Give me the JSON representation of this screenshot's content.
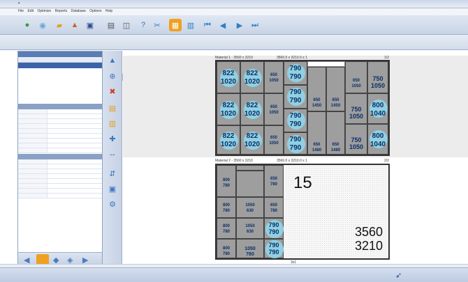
{
  "menu": [
    "File",
    "Edit",
    "Optimize",
    "Reports",
    "Database",
    "Options",
    "Help"
  ],
  "sheet1": {
    "header": "Material 1 - 3560 x 3210",
    "dims": "3560.0 x 3210.0 x 1",
    "page": "1/2",
    "pieces": [
      {
        "w": "822",
        "h": "1020"
      },
      {
        "w": "822",
        "h": "1020"
      },
      {
        "w": "650",
        "h": "1050"
      },
      {
        "w": "790",
        "h": "790"
      },
      {
        "w": "790",
        "h": "790"
      },
      {
        "w": "790",
        "h": "790"
      },
      {
        "w": "650",
        "h": "1450"
      },
      {
        "w": "650",
        "h": "1450"
      },
      {
        "w": "650",
        "h": "1050"
      },
      {
        "w": "750",
        "h": "1050"
      },
      {
        "w": "750",
        "h": "1050"
      },
      {
        "w": "800",
        "h": "1040"
      },
      {
        "w": "800",
        "h": "1040"
      },
      {
        "w": "650",
        "h": "1480"
      },
      {
        "w": "650",
        "h": "1480"
      }
    ]
  },
  "sheet2": {
    "header": "Material 2 - 3560 x 3210",
    "dims": "3560.0 x 3210.0 x 1",
    "page": "2/2",
    "count": "15",
    "width": "3560",
    "height": "3210",
    "bottom_label": "3x1",
    "pieces": [
      {
        "w": "800",
        "h": "780"
      },
      {
        "w": "650",
        "h": "780"
      },
      {
        "w": "800",
        "h": "780"
      },
      {
        "w": "1050",
        "h": "630"
      },
      {
        "w": "650",
        "h": "780"
      },
      {
        "w": "800",
        "h": "780"
      },
      {
        "w": "1050",
        "h": "630"
      },
      {
        "w": "790",
        "h": "790"
      },
      {
        "w": "800",
        "h": "780"
      },
      {
        "w": "1050",
        "h": "780"
      },
      {
        "w": "790",
        "h": "790"
      }
    ]
  },
  "colors": {
    "accent": "#5b7db5",
    "piece": "#9e9e9e",
    "circle": "#8fd3e6",
    "dim_text": "#0b2f66"
  },
  "icons": [
    "new-icon",
    "open-icon",
    "save-icon",
    "print-icon",
    "optimize-icon",
    "first-icon",
    "prev-icon",
    "next-icon",
    "last-icon"
  ]
}
